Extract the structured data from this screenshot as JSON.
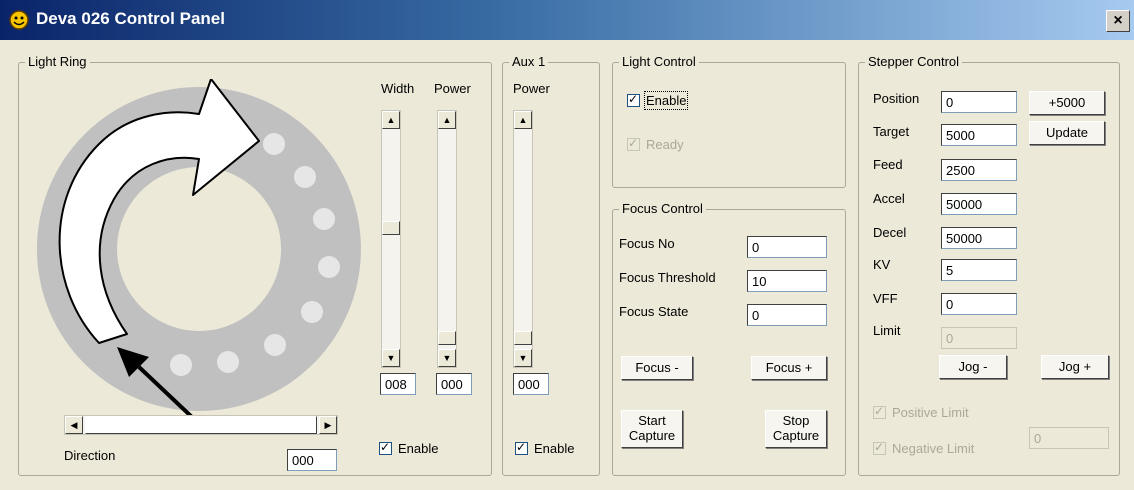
{
  "window": {
    "title": "Deva 026 Control Panel",
    "close_glyph": "×",
    "icon": "app-smiley-icon"
  },
  "light_ring": {
    "legend": "Light Ring",
    "width_label": "Width",
    "power_label": "Power",
    "width_value": "008",
    "power_value": "000",
    "direction_label": "Direction",
    "direction_value": "000",
    "enable_label": "Enable",
    "ring_color": "#c0c0c0",
    "led_color": "#e6e6e6"
  },
  "aux1": {
    "legend": "Aux 1",
    "power_label": "Power",
    "power_value": "000",
    "enable_label": "Enable"
  },
  "light_control": {
    "legend": "Light Control",
    "enable_label": "Enable",
    "ready_label": "Ready"
  },
  "focus_control": {
    "legend": "Focus Control",
    "rows": [
      {
        "label": "Focus No",
        "value": "0"
      },
      {
        "label": "Focus Threshold",
        "value": "10"
      },
      {
        "label": "Focus State",
        "value": "0"
      }
    ],
    "focus_minus_label": "Focus -",
    "focus_plus_label": "Focus +",
    "start_capture_line1": "Start",
    "start_capture_line2": "Capture",
    "stop_capture_line1": "Stop",
    "stop_capture_line2": "Capture"
  },
  "stepper_control": {
    "legend": "Stepper Control",
    "rows": [
      {
        "label": "Position",
        "value": "0"
      },
      {
        "label": "Target",
        "value": "5000"
      },
      {
        "label": "Feed",
        "value": "2500"
      },
      {
        "label": "Accel",
        "value": "50000"
      },
      {
        "label": "Decel",
        "value": "50000"
      },
      {
        "label": "KV",
        "value": "5"
      },
      {
        "label": "VFF",
        "value": "0"
      },
      {
        "label": "Limit",
        "value": "0"
      }
    ],
    "plus5000_label": "+5000",
    "update_label": "Update",
    "jog_minus_label": "Jog -",
    "jog_plus_label": "Jog +",
    "positive_limit_label": "Positive Limit",
    "negative_limit_label": "Negative Limit",
    "limit_readout": "0"
  }
}
